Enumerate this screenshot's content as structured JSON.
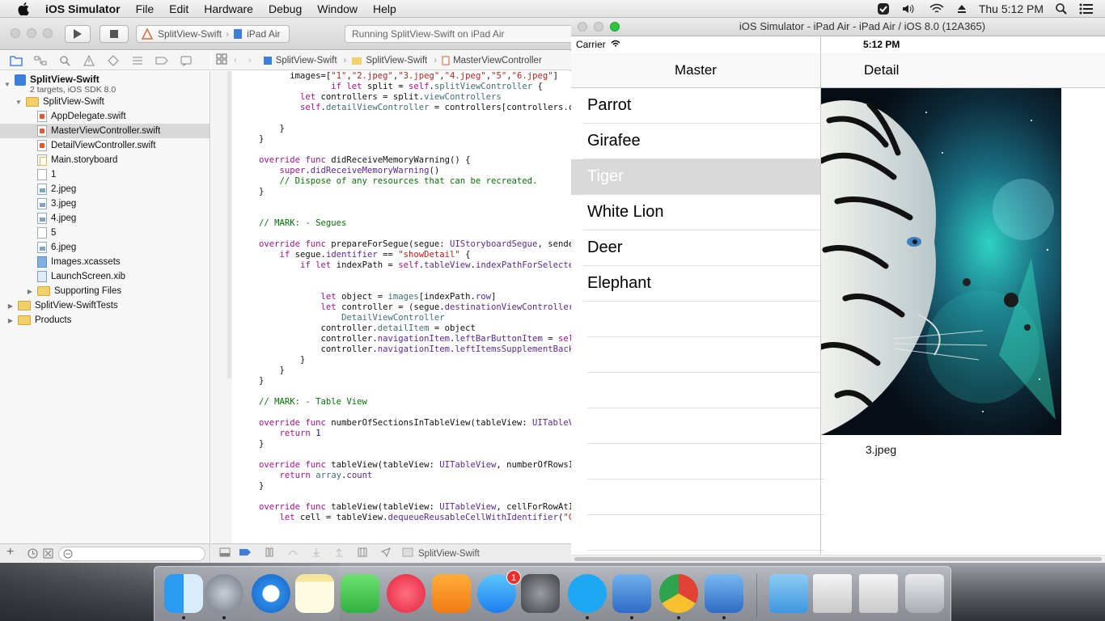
{
  "menubar": {
    "app_name": "iOS Simulator",
    "menus": [
      "File",
      "Edit",
      "Hardware",
      "Debug",
      "Window",
      "Help"
    ],
    "clock": "Thu 5:12 PM",
    "status_icons": [
      "skype-icon",
      "volume-icon",
      "wifi-icon",
      "eject-icon",
      "spotlight-icon",
      "notification-center-icon"
    ]
  },
  "xcode": {
    "scheme": "SplitView-Swift",
    "destination": "iPad Air",
    "activity": "Running SplitView-Swift on iPad Air",
    "jumpbar": [
      "SplitView-Swift",
      "SplitView-Swift",
      "MasterViewController"
    ],
    "navigator": {
      "project_name": "SplitView-Swift",
      "project_subtitle": "2 targets, iOS SDK 8.0",
      "items": [
        {
          "label": "SplitView-Swift",
          "type": "folder"
        },
        {
          "label": "AppDelegate.swift",
          "type": "swift"
        },
        {
          "label": "MasterViewController.swift",
          "type": "swift",
          "selected": true
        },
        {
          "label": "DetailViewController.swift",
          "type": "swift"
        },
        {
          "label": "Main.storyboard",
          "type": "storyboard"
        },
        {
          "label": "1",
          "type": "plain"
        },
        {
          "label": "2.jpeg",
          "type": "image"
        },
        {
          "label": "3.jpeg",
          "type": "image"
        },
        {
          "label": "4.jpeg",
          "type": "image"
        },
        {
          "label": "5",
          "type": "plain"
        },
        {
          "label": "6.jpeg",
          "type": "image"
        },
        {
          "label": "Images.xcassets",
          "type": "assets"
        },
        {
          "label": "LaunchScreen.xib",
          "type": "xib"
        },
        {
          "label": "Supporting Files",
          "type": "folder"
        },
        {
          "label": "SplitView-SwiftTests",
          "type": "folder"
        },
        {
          "label": "Products",
          "type": "folder"
        }
      ]
    },
    "editor_footer": "SplitView-Swift"
  },
  "simulator": {
    "window_title": "iOS Simulator - iPad Air - iPad Air / iOS 8.0 (12A365)",
    "carrier": "Carrier",
    "time": "5:12 PM",
    "master_title": "Master",
    "detail_title": "Detail",
    "master_items": [
      "Parrot",
      "Girafee",
      "Tiger",
      "White Lion",
      "Deer",
      "Elephant"
    ],
    "selected_item": "Tiger",
    "detail_label": "3.jpeg"
  },
  "dock": {
    "apps": [
      "finder-icon",
      "launchpad-icon",
      "safari-icon",
      "notes-icon",
      "facetime-icon",
      "itunes-icon",
      "ibooks-icon",
      "app-store-icon",
      "system-preferences-icon",
      "skype-icon",
      "xcode-icon",
      "chrome-icon",
      "ios-simulator-icon",
      "applications-folder-icon",
      "recent-screenshot-icon",
      "recent-screenshot-icon",
      "trash-icon"
    ],
    "app_store_badge": "1"
  },
  "colors": {
    "selection_gray": "#d9d9d9",
    "keyword": "#aa0d91",
    "string": "#c41a16",
    "comment": "#007400"
  }
}
